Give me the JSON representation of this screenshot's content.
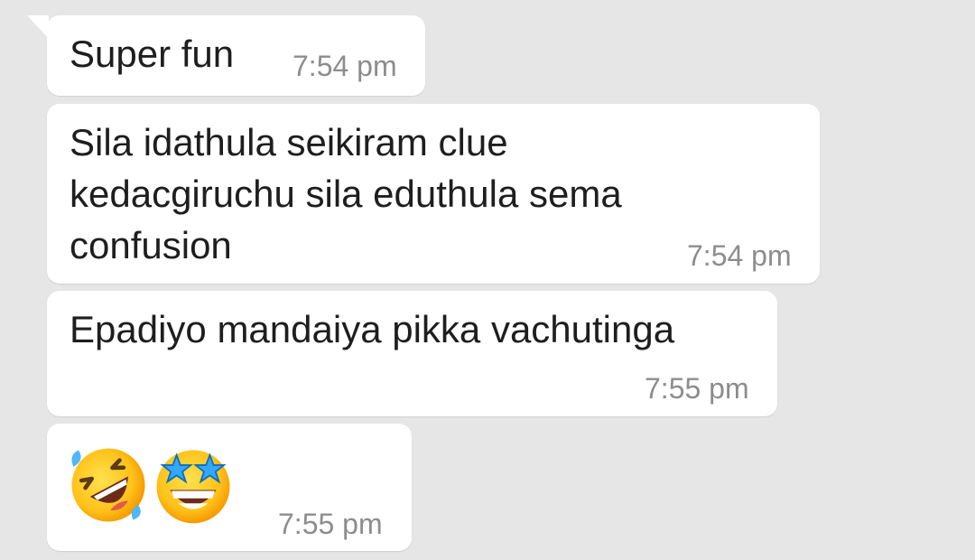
{
  "chat": {
    "messages": [
      {
        "lines": [
          "Super fun"
        ],
        "time": "7:54 pm"
      },
      {
        "lines": [
          "Sila idathula seikiram clue",
          "kedacgiruchu sila eduthula sema",
          "confusion"
        ],
        "time": "7:54 pm"
      },
      {
        "lines": [
          "Epadiyo mandaiya pikka vachutinga"
        ],
        "time": "7:55 pm"
      },
      {
        "emojis": [
          "rolling-on-the-floor-laughing",
          "star-struck"
        ],
        "time": "7:55 pm"
      }
    ]
  },
  "colors": {
    "background": "#e6e6e6",
    "bubble": "#ffffff",
    "text": "#1e1e1e",
    "timestamp": "#8d8d8d"
  }
}
